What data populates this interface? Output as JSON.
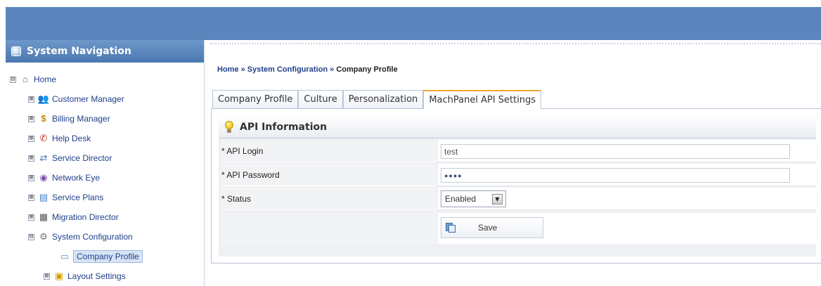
{
  "sidebar": {
    "title": "System Navigation",
    "items": [
      {
        "label": "Home",
        "icon": "home-icon",
        "expander": "⊟"
      },
      {
        "label": "Customer Manager",
        "icon": "customer-manager-icon",
        "expander": "⊞"
      },
      {
        "label": "Billing Manager",
        "icon": "billing-manager-icon",
        "expander": "⊞"
      },
      {
        "label": "Help Desk",
        "icon": "help-desk-icon",
        "expander": "⊞"
      },
      {
        "label": "Service Director",
        "icon": "service-director-icon",
        "expander": "⊞"
      },
      {
        "label": "Network Eye",
        "icon": "network-eye-icon",
        "expander": "⊞"
      },
      {
        "label": "Service Plans",
        "icon": "service-plans-icon",
        "expander": "⊞"
      },
      {
        "label": "Migration Director",
        "icon": "migration-director-icon",
        "expander": "⊞"
      },
      {
        "label": "System Configuration",
        "icon": "system-configuration-icon",
        "expander": "⊟"
      },
      {
        "label": "Company Profile",
        "icon": "company-profile-icon",
        "expander": ""
      },
      {
        "label": "Layout Settings",
        "icon": "layout-settings-icon",
        "expander": "⊞"
      }
    ]
  },
  "breadcrumb": {
    "home": "Home",
    "sep1": " » ",
    "section": "System Configuration",
    "sep2": " » ",
    "current": "Company Profile"
  },
  "tabs": [
    {
      "label": "Company Profile",
      "active": false
    },
    {
      "label": "Culture",
      "active": false
    },
    {
      "label": "Personalization",
      "active": false
    },
    {
      "label": "MachPanel API Settings",
      "active": true
    }
  ],
  "panel": {
    "title": "API Information",
    "fields": {
      "api_login": {
        "label": "* API Login",
        "value": "test"
      },
      "api_password": {
        "label": "* API Password",
        "value": "●●●●"
      },
      "status": {
        "label": "* Status",
        "value": "Enabled"
      }
    },
    "save_label": "Save"
  },
  "colors": {
    "banner": "#5a86bd",
    "sidebar_header": "#4a78b0",
    "link": "#1f3f8a",
    "active_tab_accent": "#f0a530"
  }
}
